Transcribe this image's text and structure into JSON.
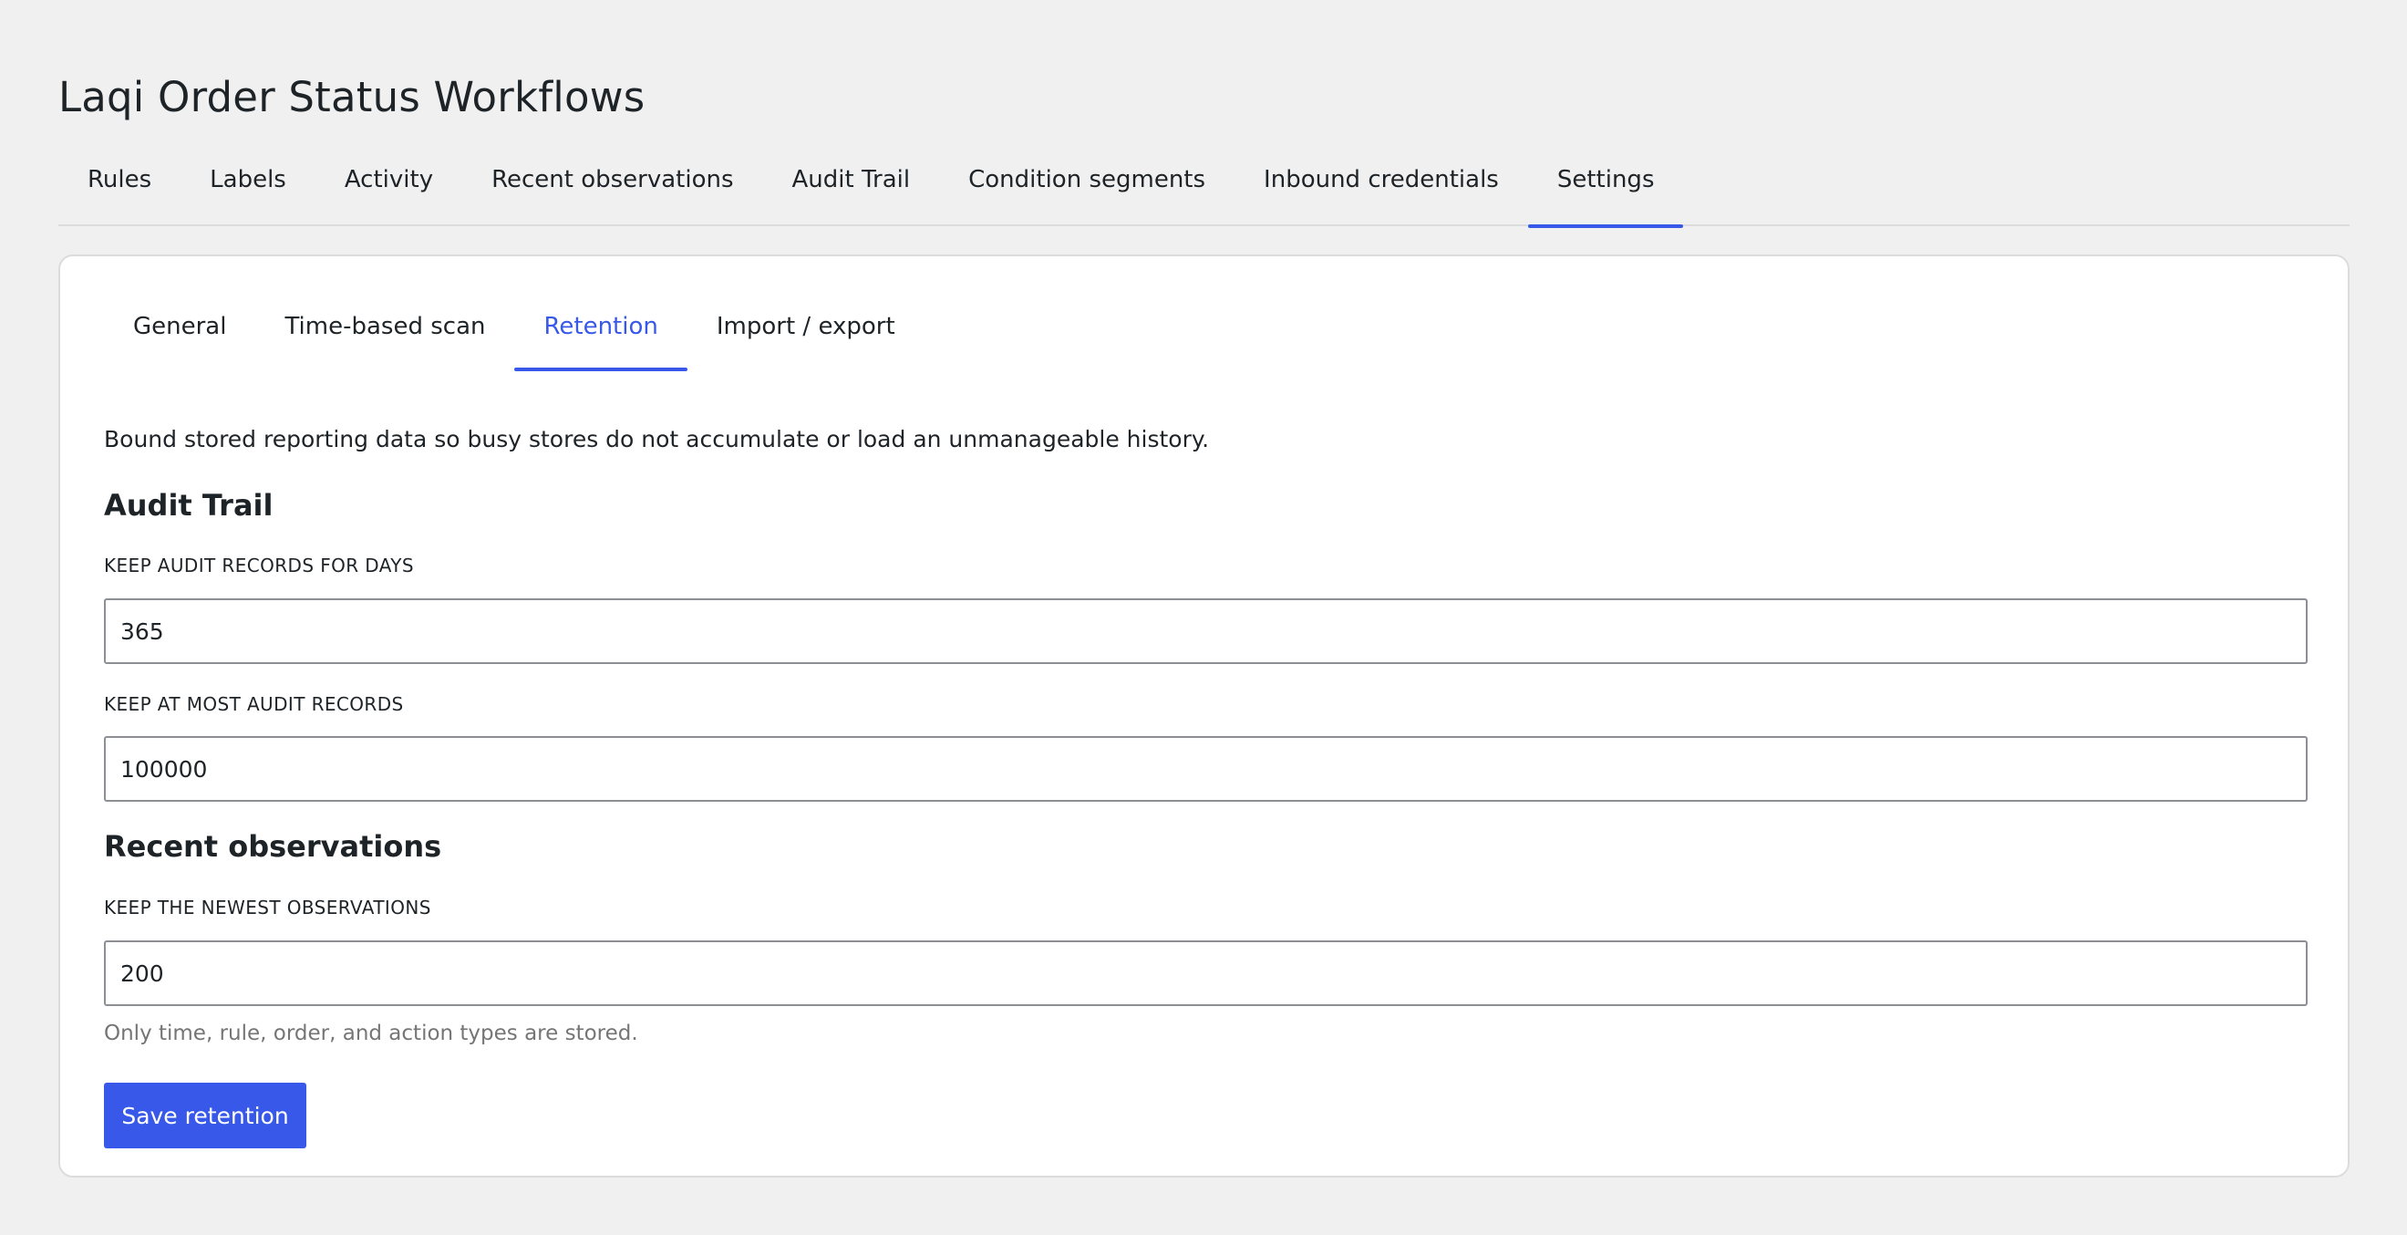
{
  "page": {
    "title": "Laqi Order Status Workflows"
  },
  "main_tabs": [
    {
      "label": "Rules"
    },
    {
      "label": "Labels"
    },
    {
      "label": "Activity"
    },
    {
      "label": "Recent observations"
    },
    {
      "label": "Audit Trail"
    },
    {
      "label": "Condition segments"
    },
    {
      "label": "Inbound credentials"
    },
    {
      "label": "Settings",
      "active": true
    }
  ],
  "sub_tabs": [
    {
      "label": "General"
    },
    {
      "label": "Time-based scan"
    },
    {
      "label": "Retention",
      "active": true
    },
    {
      "label": "Import / export"
    }
  ],
  "retention": {
    "intro": "Bound stored reporting data so busy stores do not accumulate or load an unmanageable history.",
    "audit_heading": "Audit Trail",
    "audit_days_label": "KEEP AUDIT RECORDS FOR DAYS",
    "audit_days_value": "365",
    "audit_max_label": "KEEP AT MOST AUDIT RECORDS",
    "audit_max_value": "100000",
    "obs_heading": "Recent observations",
    "obs_newest_label": "KEEP THE NEWEST OBSERVATIONS",
    "obs_newest_value": "200",
    "obs_help": "Only time, rule, order, and action types are stored.",
    "save_label": "Save retention"
  },
  "colors": {
    "accent": "#3858e9",
    "background": "#f0f0f1",
    "text": "#1d2327",
    "muted": "#757575"
  }
}
